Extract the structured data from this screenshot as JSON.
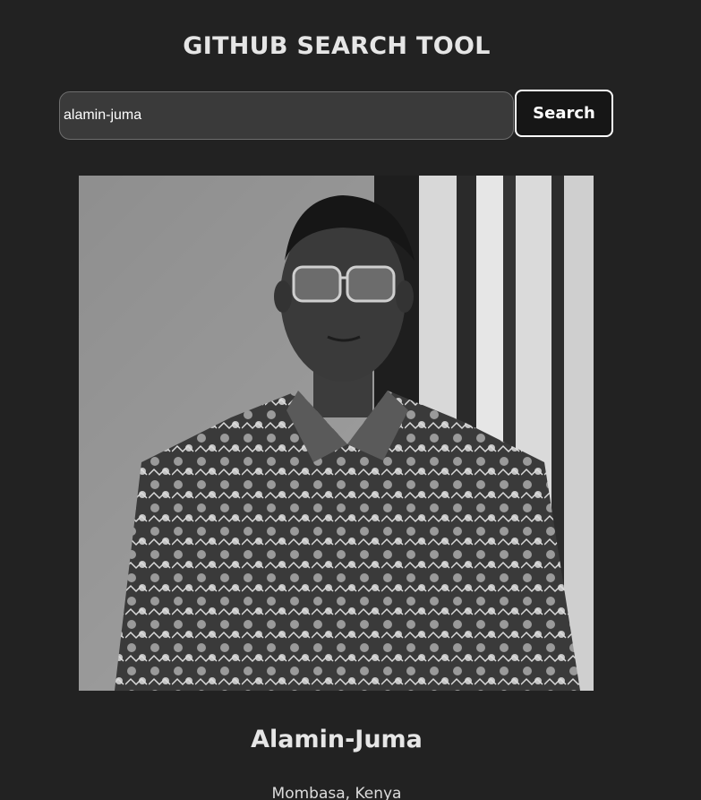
{
  "header": {
    "title": "GITHUB SEARCH TOOL"
  },
  "search": {
    "value": "alamin-juma",
    "placeholder": "",
    "button_label": "Search"
  },
  "profile": {
    "avatar_icon": "user-avatar-photo",
    "name": "Alamin-Juma",
    "location": "Mombasa, Kenya"
  },
  "colors": {
    "background": "#222222",
    "input_background": "#3a3a3a",
    "button_background": "#161616",
    "text": "#e6e6e6"
  }
}
